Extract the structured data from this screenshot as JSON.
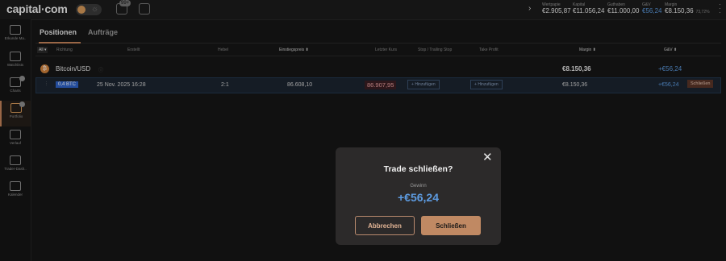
{
  "topbar": {
    "logo": "capital·com",
    "notification_count": "99+",
    "stats": [
      {
        "label": "Wertpapie",
        "value": "€2.905,87",
        "color": "normal"
      },
      {
        "label": "Kapital",
        "value": "€11.056,24",
        "color": "normal"
      },
      {
        "label": "Guthaben",
        "value": "€11.000,00",
        "color": "normal"
      },
      {
        "label": "G&V",
        "value": "€56,24",
        "color": "blue"
      },
      {
        "label": "Margin",
        "value": "€8.150,36",
        "sub": "73,72%",
        "color": "normal"
      }
    ]
  },
  "sidebar": {
    "items": [
      {
        "label": "Erkunde Ma.."
      },
      {
        "label": "Watchlists"
      },
      {
        "label": "Charts"
      },
      {
        "label": "Portfolio"
      },
      {
        "label": "Verlauf"
      },
      {
        "label": "Trader-Dash.."
      },
      {
        "label": "Kalender"
      }
    ]
  },
  "tabs": {
    "positions": "Positionen",
    "orders": "Aufträge"
  },
  "table": {
    "all_select": "All ▾",
    "headers": {
      "richtung": "Richtung",
      "erstellt": "Erstellt",
      "hebel": "Hebel",
      "einstiegspreis": "Einstiegspreis ⬍",
      "letzter_kurs": "Letzter Kurs",
      "stop": "Stop / Trailing Stop",
      "take_profit": "Take Profit",
      "margin": "Margin ⬍",
      "guv": "G&V ⬍"
    },
    "group": {
      "coin_symbol": "₿",
      "name": "Bitcoin/USD",
      "margin": "€8.150,36",
      "pnl": "+€56,24"
    },
    "row": {
      "direction": "0,4 BTC",
      "created": "25 Nov. 2025 16:28",
      "leverage": "2:1",
      "entry": "86.608,10",
      "last": "86.907,95",
      "stop_btn": "Hinzufügen",
      "tp_btn": "Hinzufügen",
      "margin": "€8.150,36",
      "pnl": "+€56,24",
      "close": "Schließen"
    }
  },
  "modal": {
    "title": "Trade schließen?",
    "profit_label": "Gewinn",
    "profit_value": "+€56,24",
    "cancel": "Abbrechen",
    "confirm": "Schließen"
  },
  "colors": {
    "accent": "#c08963",
    "positive": "#5d9be0",
    "background": "#161616",
    "modal": "#2c2a2a"
  }
}
